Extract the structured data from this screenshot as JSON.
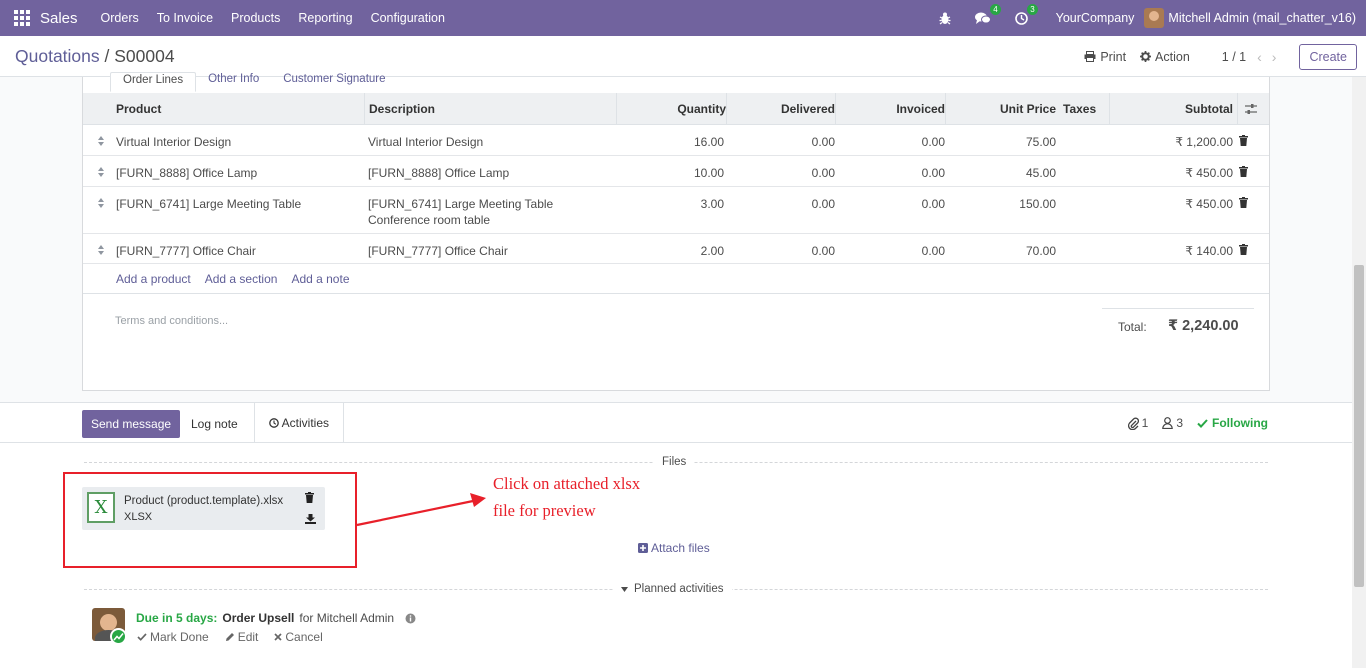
{
  "navbar": {
    "brand": "Sales",
    "menu": [
      "Orders",
      "To Invoice",
      "Products",
      "Reporting",
      "Configuration"
    ],
    "messages_count": "4",
    "activities_count": "3",
    "company": "YourCompany",
    "user": "Mitchell Admin (mail_chatter_v16)"
  },
  "control_panel": {
    "breadcrumb_parent": "Quotations",
    "breadcrumb_separator": " / ",
    "breadcrumb_current": "S00004",
    "print_label": "Print",
    "action_label": "Action",
    "pager": "1 / 1",
    "create_label": "Create"
  },
  "tabs": [
    "Order Lines",
    "Other Info",
    "Customer Signature"
  ],
  "order_lines": {
    "headers": {
      "product": "Product",
      "description": "Description",
      "quantity": "Quantity",
      "delivered": "Delivered",
      "invoiced": "Invoiced",
      "unit_price": "Unit Price",
      "taxes": "Taxes",
      "subtotal": "Subtotal"
    },
    "rows": [
      {
        "product": "Virtual Interior Design",
        "description": "Virtual Interior Design",
        "description2": "",
        "quantity": "16.00",
        "delivered": "0.00",
        "invoiced": "0.00",
        "unit_price": "75.00",
        "subtotal": "₹ 1,200.00"
      },
      {
        "product": "[FURN_8888] Office Lamp",
        "description": "[FURN_8888] Office Lamp",
        "description2": "",
        "quantity": "10.00",
        "delivered": "0.00",
        "invoiced": "0.00",
        "unit_price": "45.00",
        "subtotal": "₹ 450.00"
      },
      {
        "product": "[FURN_6741] Large Meeting Table",
        "description": "[FURN_6741] Large Meeting Table",
        "description2": "Conference room table",
        "quantity": "3.00",
        "delivered": "0.00",
        "invoiced": "0.00",
        "unit_price": "150.00",
        "subtotal": "₹ 450.00"
      },
      {
        "product": "[FURN_7777] Office Chair",
        "description": "[FURN_7777] Office Chair",
        "description2": "",
        "quantity": "2.00",
        "delivered": "0.00",
        "invoiced": "0.00",
        "unit_price": "70.00",
        "subtotal": "₹ 140.00"
      }
    ],
    "add_product": "Add a product",
    "add_section": "Add a section",
    "add_note": "Add a note"
  },
  "terms_placeholder": "Terms and conditions...",
  "totals": {
    "label": "Total:",
    "value": "₹ 2,240.00"
  },
  "chatter": {
    "send_message": "Send message",
    "log_note": "Log note",
    "activities": "Activities",
    "attachments_count": "1",
    "followers_count": "3",
    "following": "Following",
    "files_label": "Files",
    "attach_files": "Attach files",
    "planned_label": "Planned activities"
  },
  "attachment": {
    "name": "Product (product.template).xlsx",
    "ext": "XLSX",
    "icon_letter": "X"
  },
  "annotation": {
    "line1": "Click on attached xlsx",
    "line2": "file for preview"
  },
  "activity": {
    "due": "Due in 5 days:",
    "name": "Order Upsell",
    "assignee": "for Mitchell Admin",
    "mark_done": "Mark Done",
    "edit": "Edit",
    "cancel": "Cancel"
  },
  "colors": {
    "brand": "#71639e",
    "link": "#5f5e97",
    "success": "#28a745",
    "annotation": "#e8202a"
  }
}
